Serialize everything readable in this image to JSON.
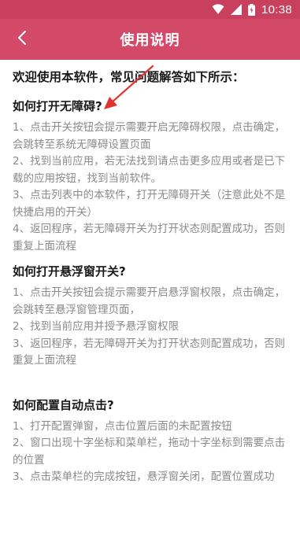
{
  "status_bar": {
    "time": "10:38",
    "icons": [
      "wifi-icon",
      "signal-icon",
      "battery-icon"
    ]
  },
  "app_bar": {
    "title": "使用说明",
    "back_icon": "chevron-left-icon"
  },
  "content": {
    "intro": "欢迎使用本软件，常见问题解答如下所示：",
    "sections": [
      {
        "title": "如何打开无障碍?",
        "steps": [
          "1、点击开关按钮会提示需要开启无障碍权限，点击确定，会跳转至系统无障碍设置页面",
          " 2、找到当前应用，若无法找到请点击更多应用或者是已下载的应用按钮，找到当前软件。",
          " 3、点击列表中的本软件，打开无障碍开关（注意此处不是快捷启用的开关）",
          " 4、返回程序，若无障碍开关为打开状态则配置成功，否则重复上面流程"
        ]
      },
      {
        "title": "如何打开悬浮窗开关?",
        "steps": [
          " 1、点击开关按钮会提示需要开启悬浮窗权限，点击确定，会跳转至悬浮窗管理页面，",
          " 2、找到当前应用并授予悬浮窗权限",
          " 3、返回程序，若无障碍开关为打开状态则配置成功，否则重复上面流程"
        ]
      },
      {
        "title": "如何配置自动点击?",
        "steps": [
          " 1、打开配置弹窗，点击位置后面的未配置按钮",
          " 2、窗口出现十字坐标和菜单栏，拖动十字坐标到需要点击的位置",
          " 3、点击菜单栏的完成按钮，悬浮窗关闭，配置位置成功"
        ]
      }
    ]
  },
  "colors": {
    "status_bar": "#c8405e",
    "app_bar": "#d24a68",
    "arrow": "#e0332f",
    "step_text": "#8a8a8a"
  }
}
